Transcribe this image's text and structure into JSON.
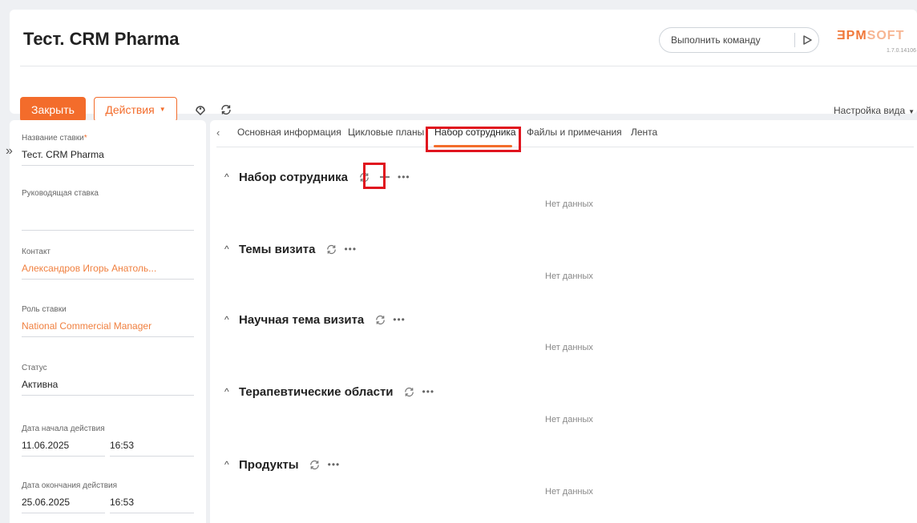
{
  "header": {
    "title": "Тест. CRM Pharma",
    "command_placeholder": "Выполнить команду",
    "logo_main": "ƎPM",
    "logo_soft": "SOFT",
    "version": "1.7.0.14106"
  },
  "toolbar": {
    "close_label": "Закрыть",
    "actions_label": "Действия",
    "view_setup_label": "Настройка вида"
  },
  "form": {
    "rate_name": {
      "label": "Название ставки",
      "required_mark": "*",
      "value": "Тест. CRM Pharma"
    },
    "lead_rate": {
      "label": "Руководящая ставка",
      "value": ""
    },
    "contact": {
      "label": "Контакт",
      "value": "Александров Игорь Анатоль..."
    },
    "role": {
      "label": "Роль ставки",
      "value": "National Commercial Manager"
    },
    "status": {
      "label": "Статус",
      "value": "Активна"
    },
    "start": {
      "label": "Дата начала действия",
      "date": "11.06.2025",
      "time": "16:53"
    },
    "end": {
      "label": "Дата окончания действия",
      "date": "25.06.2025",
      "time": "16:53"
    }
  },
  "tabs": {
    "items": [
      "Основная информация",
      "Цикловые планы",
      "Набор сотрудника",
      "Файлы и примечания",
      "Лента"
    ],
    "active": "Набор сотрудника"
  },
  "sections": [
    {
      "title": "Набор сотрудника",
      "empty_text": "Нет данных"
    },
    {
      "title": "Темы визита",
      "empty_text": "Нет данных"
    },
    {
      "title": "Научная тема визита",
      "empty_text": "Нет данных"
    },
    {
      "title": "Терапевтические области",
      "empty_text": "Нет данных"
    },
    {
      "title": "Продукты",
      "empty_text": "Нет данных"
    }
  ],
  "colors": {
    "accent": "#f36c2b",
    "highlight": "#e0141e"
  }
}
